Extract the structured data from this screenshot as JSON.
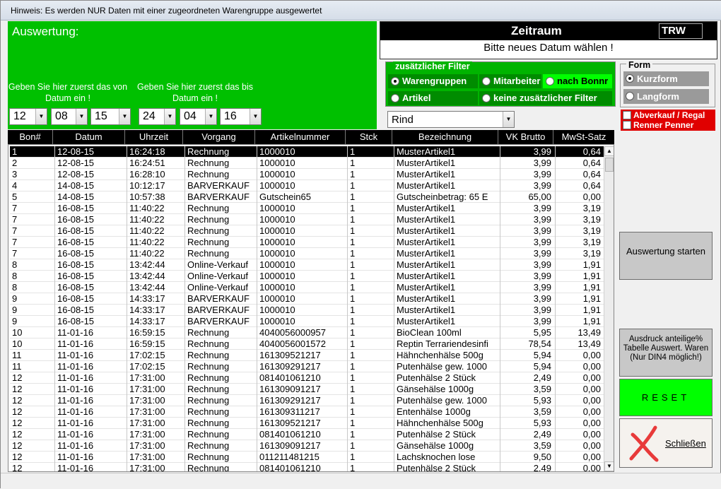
{
  "window": {
    "title": "Hinweis: Es werden NUR Daten mit einer zugeordneten Warengruppe ausgewertet"
  },
  "left_panel": {
    "title": "Auswertung:",
    "from_label": "Geben Sie hier zuerst das von Datum ein !",
    "to_label": "Geben Sie hier zuerst das bis Datum ein !",
    "from_date": {
      "day": "12",
      "month": "08",
      "year": "15"
    },
    "to_date": {
      "day": "24",
      "month": "04",
      "year": "16"
    }
  },
  "zeitraum": {
    "title": "Zeitraum",
    "code": "TRW",
    "message": "Bitte neues Datum wählen !"
  },
  "filter": {
    "legend": "zusätzlicher Filter",
    "options": [
      "Warengruppen",
      "Mitarbeiter",
      "nach Bonnr",
      "Artikel",
      "keine zusätzlicher Filter"
    ],
    "selected": "Warengruppen",
    "group_value": "Rind"
  },
  "form": {
    "legend": "Form",
    "options": [
      "Kurzform",
      "Langform"
    ],
    "selected": "Kurzform"
  },
  "checkboxes": [
    "Abverkauf / Regal",
    "Renner Penner"
  ],
  "table": {
    "columns": [
      "Bon#",
      "Datum",
      "Uhrzeit",
      "Vorgang",
      "Artikelnummer",
      "Stck",
      "Bezeichnung",
      "VK Brutto",
      "MwSt-Satz"
    ],
    "rows": [
      [
        "1",
        "12-08-15",
        "16:24:18",
        "Rechnung",
        "1000010",
        "1",
        "MusterArtikel1",
        "3,99",
        "0,64"
      ],
      [
        "2",
        "12-08-15",
        "16:24:51",
        "Rechnung",
        "1000010",
        "1",
        "MusterArtikel1",
        "3,99",
        "0,64"
      ],
      [
        "3",
        "12-08-15",
        "16:28:10",
        "Rechnung",
        "1000010",
        "1",
        "MusterArtikel1",
        "3,99",
        "0,64"
      ],
      [
        "4",
        "14-08-15",
        "10:12:17",
        "BARVERKAUF",
        "1000010",
        "1",
        "MusterArtikel1",
        "3,99",
        "0,64"
      ],
      [
        "5",
        "14-08-15",
        "10:57:38",
        "BARVERKAUF",
        "Gutschein65",
        "1",
        "Gutscheinbetrag: 65 E",
        "65,00",
        "0,00"
      ],
      [
        "7",
        "16-08-15",
        "11:40:22",
        "Rechnung",
        "1000010",
        "1",
        "MusterArtikel1",
        "3,99",
        "3,19"
      ],
      [
        "7",
        "16-08-15",
        "11:40:22",
        "Rechnung",
        "1000010",
        "1",
        "MusterArtikel1",
        "3,99",
        "3,19"
      ],
      [
        "7",
        "16-08-15",
        "11:40:22",
        "Rechnung",
        "1000010",
        "1",
        "MusterArtikel1",
        "3,99",
        "3,19"
      ],
      [
        "7",
        "16-08-15",
        "11:40:22",
        "Rechnung",
        "1000010",
        "1",
        "MusterArtikel1",
        "3,99",
        "3,19"
      ],
      [
        "7",
        "16-08-15",
        "11:40:22",
        "Rechnung",
        "1000010",
        "1",
        "MusterArtikel1",
        "3,99",
        "3,19"
      ],
      [
        "8",
        "16-08-15",
        "13:42:44",
        "Online-Verkauf",
        "1000010",
        "1",
        "MusterArtikel1",
        "3,99",
        "1,91"
      ],
      [
        "8",
        "16-08-15",
        "13:42:44",
        "Online-Verkauf",
        "1000010",
        "1",
        "MusterArtikel1",
        "3,99",
        "1,91"
      ],
      [
        "8",
        "16-08-15",
        "13:42:44",
        "Online-Verkauf",
        "1000010",
        "1",
        "MusterArtikel1",
        "3,99",
        "1,91"
      ],
      [
        "9",
        "16-08-15",
        "14:33:17",
        "BARVERKAUF",
        "1000010",
        "1",
        "MusterArtikel1",
        "3,99",
        "1,91"
      ],
      [
        "9",
        "16-08-15",
        "14:33:17",
        "BARVERKAUF",
        "1000010",
        "1",
        "MusterArtikel1",
        "3,99",
        "1,91"
      ],
      [
        "9",
        "16-08-15",
        "14:33:17",
        "BARVERKAUF",
        "1000010",
        "1",
        "MusterArtikel1",
        "3,99",
        "1,91"
      ],
      [
        "10",
        "11-01-16",
        "16:59:15",
        "Rechnung",
        "4040056000957",
        "1",
        "BioClean 100ml",
        "5,95",
        "13,49"
      ],
      [
        "10",
        "11-01-16",
        "16:59:15",
        "Rechnung",
        "4040056001572",
        "1",
        "Reptin Terrariendesinfi",
        "78,54",
        "13,49"
      ],
      [
        "11",
        "11-01-16",
        "17:02:15",
        "Rechnung",
        "161309521217",
        "1",
        "Hähnchenhälse 500g",
        "5,94",
        "0,00"
      ],
      [
        "11",
        "11-01-16",
        "17:02:15",
        "Rechnung",
        "161309291217",
        "1",
        "Putenhälse gew. 1000",
        "5,94",
        "0,00"
      ],
      [
        "12",
        "11-01-16",
        "17:31:00",
        "Rechnung",
        "081401061210",
        "1",
        "Putenhälse 2 Stück",
        "2,49",
        "0,00"
      ],
      [
        "12",
        "11-01-16",
        "17:31:00",
        "Rechnung",
        "161309091217",
        "1",
        "Gänsehälse 1000g",
        "3,59",
        "0,00"
      ],
      [
        "12",
        "11-01-16",
        "17:31:00",
        "Rechnung",
        "161309291217",
        "1",
        "Putenhälse gew. 1000",
        "5,93",
        "0,00"
      ],
      [
        "12",
        "11-01-16",
        "17:31:00",
        "Rechnung",
        "161309311217",
        "1",
        "Entenhälse 1000g",
        "3,59",
        "0,00"
      ],
      [
        "12",
        "11-01-16",
        "17:31:00",
        "Rechnung",
        "161309521217",
        "1",
        "Hähnchenhälse 500g",
        "5,93",
        "0,00"
      ],
      [
        "12",
        "11-01-16",
        "17:31:00",
        "Rechnung",
        "081401061210",
        "1",
        "Putenhälse 2 Stück",
        "2,49",
        "0,00"
      ],
      [
        "12",
        "11-01-16",
        "17:31:00",
        "Rechnung",
        "161309091217",
        "1",
        "Gänsehälse 1000g",
        "3,59",
        "0,00"
      ],
      [
        "12",
        "11-01-16",
        "17:31:00",
        "Rechnung",
        "011211481215",
        "1",
        "Lachsknochen lose",
        "9,50",
        "0,00"
      ],
      [
        "12",
        "11-01-16",
        "17:31:00",
        "Rechnung",
        "081401061210",
        "1",
        "Putenhälse 2 Stück",
        "2,49",
        "0,00"
      ]
    ],
    "selected_row": 0
  },
  "buttons": {
    "auswertung": "Auswertung starten",
    "ausdruck": "Ausdruck anteilige% Tabelle Auswert. Waren (Nur DIN4 möglich!)",
    "reset": "RESET",
    "close": "Schließen"
  },
  "colors": {
    "green": "#00c000",
    "bright_green": "#00ff00",
    "red": "#e00000",
    "header_black": "#000000"
  },
  "icons": {
    "close": "red-x-icon"
  }
}
